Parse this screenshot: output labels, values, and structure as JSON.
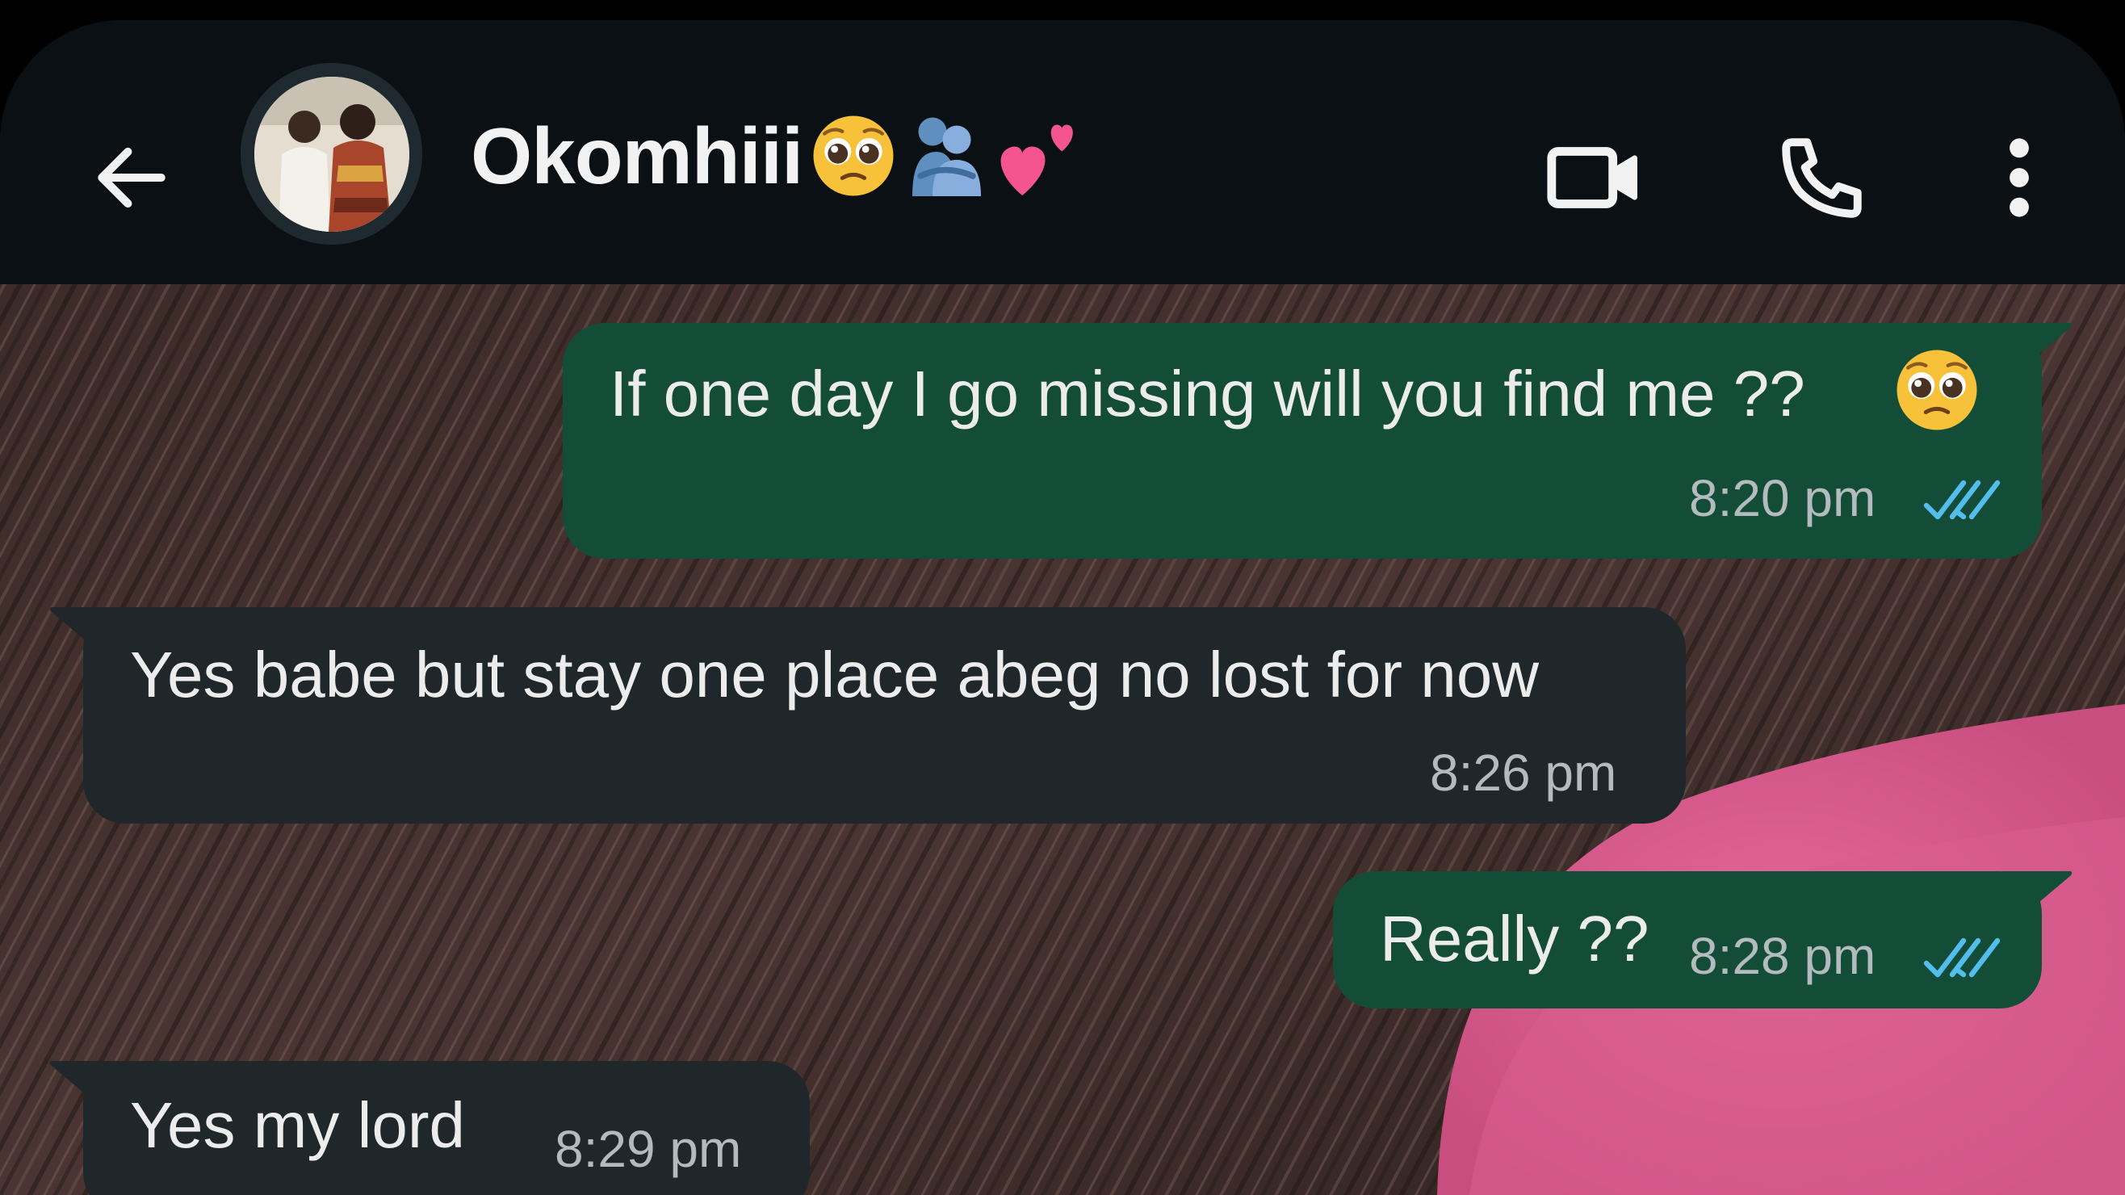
{
  "header": {
    "back_label": "Back",
    "contact_name": "Okomhiii",
    "contact_emojis": [
      "pleading-face",
      "people-hugging",
      "two-hearts"
    ],
    "icons": {
      "back": "arrow-left-icon",
      "video": "video-camera-icon",
      "call": "phone-icon",
      "menu": "more-vertical-icon"
    }
  },
  "messages": [
    {
      "direction": "outgoing",
      "text": "If one day I go missing will you find me ??",
      "emoji": "pleading-face",
      "time": "8:20 pm",
      "status": "read"
    },
    {
      "direction": "incoming",
      "text": "Yes babe but stay one place abeg no lost for now",
      "time": "8:26 pm"
    },
    {
      "direction": "outgoing",
      "text": "Really ??",
      "time": "8:28 pm",
      "status": "read"
    },
    {
      "direction": "incoming",
      "text": "Yes my lord",
      "time": "8:29 pm"
    }
  ],
  "colors": {
    "header_bg": "#0b1014",
    "outgoing_bubble": "#144d37",
    "incoming_bubble": "#1f272b",
    "read_ticks": "#53bdeb",
    "timestamp": "#b3bbbf"
  }
}
